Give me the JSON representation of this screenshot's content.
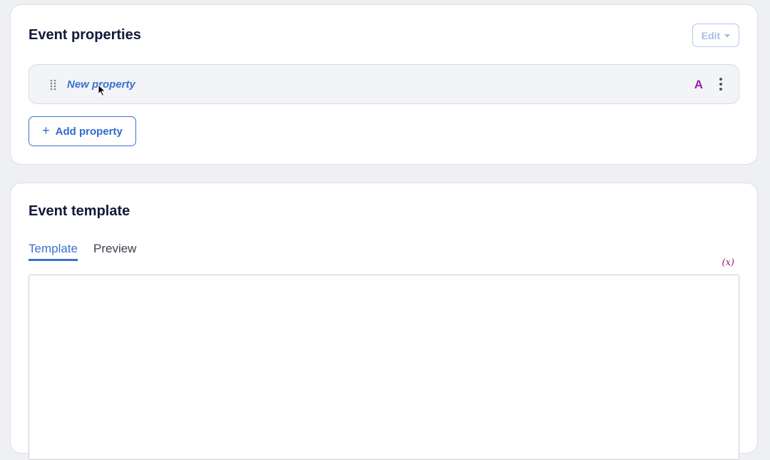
{
  "event_properties": {
    "title": "Event properties",
    "edit_label": "Edit",
    "property": {
      "name": "New property",
      "type_badge": "A"
    },
    "add_label": "Add property"
  },
  "event_template": {
    "title": "Event template",
    "tabs": [
      {
        "label": "Template",
        "active": true
      },
      {
        "label": "Preview",
        "active": false
      }
    ],
    "variable_icon": "(x)",
    "editor_value": ""
  },
  "colors": {
    "accent": "#3a72cf",
    "badge": "#9a1fa8",
    "variable": "#9a1d6a",
    "background": "#eef0f3"
  }
}
